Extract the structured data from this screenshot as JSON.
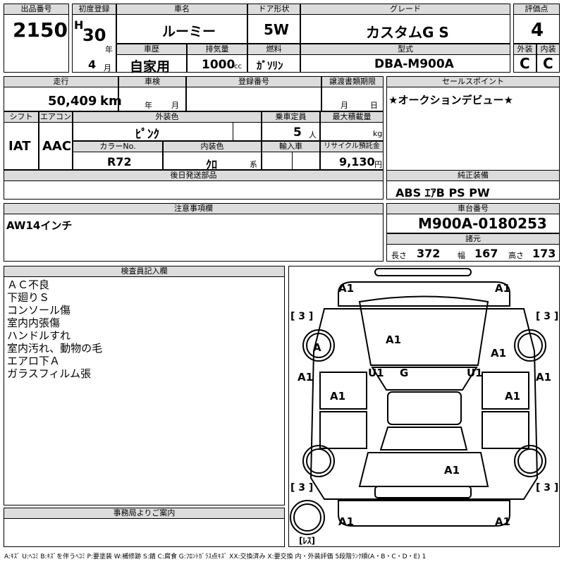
{
  "header": {
    "lot_label": "出品番号",
    "lot_value": "2150",
    "first_reg_label": "初度登録",
    "era": "H",
    "year_num": "30",
    "year_unit": "年",
    "month_num": "4",
    "month_unit": "月",
    "car_name_label": "車名",
    "car_name": "ルーミー",
    "door_label": "ドア形状",
    "door": "5W",
    "grade_label": "グレード",
    "grade": "カスタムG S",
    "score_label": "評価点",
    "score": "4",
    "history_label": "車歴",
    "history": "自家用",
    "displacement_label": "排気量",
    "displacement": "1000",
    "cc_unit": "cc",
    "fuel_label": "燃料",
    "fuel": "ｶﾞｿﾘﾝ",
    "model_label": "型式",
    "model": "DBA-M900A",
    "exterior_label": "外装",
    "exterior": "C",
    "interior_label": "内装",
    "interior": "C"
  },
  "row2": {
    "mileage_label": "走行",
    "mileage": "50,409",
    "mileage_unit": "km",
    "inspection_label": "車検",
    "inspection_year": "年",
    "inspection_month": "月",
    "reg_no_label": "登録番号",
    "transfer_label": "譲渡書類期限",
    "transfer_month": "月",
    "transfer_day": "日",
    "sales_point_label": "セールスポイント",
    "sales_point": "★オークションデビュー★",
    "shift_label": "シフト",
    "shift": "IAT",
    "aircon_label": "エアコン",
    "aircon": "AAC",
    "ext_color_label": "外装色",
    "ext_color": "ﾋﾟﾝｸ",
    "capacity_label": "乗車定員",
    "capacity": "5",
    "capacity_unit": "人",
    "max_load_label": "最大積載量",
    "max_load_unit": "kg",
    "color_no_label": "カラーNo.",
    "color_no": "R72",
    "int_color_label": "内装色",
    "int_color": "ｸﾛ",
    "int_color_unit": "系",
    "import_label": "輸入車",
    "recycle_label": "リサイクル預託金",
    "recycle": "9,130",
    "recycle_unit": "円",
    "later_parts_label": "後日発送部品",
    "equipment_label": "純正装備",
    "equipment": "ABS ｴｱB PS PW"
  },
  "notes": {
    "label": "注意事項欄",
    "text": "AW14インチ",
    "chassis_label": "車台番号",
    "chassis": "M900A-0180253",
    "spec_label": "諸元",
    "length_label": "長さ",
    "length": "372",
    "width_label": "幅",
    "width": "167",
    "height_label": "高さ",
    "height": "173"
  },
  "inspector": {
    "label": "検査員記入欄",
    "lines": [
      "ＡＣ不良",
      "下廻りＳ",
      "コンソール傷",
      "室内内張傷",
      "ハンドルすれ",
      "室内汚れ、動物の毛",
      "エアロ下Ａ",
      "ガラスフィルム張"
    ]
  },
  "office": {
    "label": "事務局よりご案内"
  },
  "diagram": {
    "tire_fl": "[ 3 ]",
    "tire_fr": "[ 3 ]",
    "tire_rl": "[ 3 ]",
    "tire_rr": "[ 3 ]",
    "spare": "[ﾚｽ]",
    "marks": {
      "front_left": "A1",
      "front_right": "A1",
      "hood": "A1",
      "fender_left_wheel": "A",
      "fender_right": "A1",
      "side_left": "A1",
      "side_right": "A1",
      "pillar_left": "U1",
      "pillar_right": "U1",
      "glass": "G",
      "door_left": "A1",
      "door_right": "A1",
      "roof": "A1",
      "rear_left": "A1",
      "rear_right": "A1"
    }
  },
  "legend": "A:ｷｽﾞ U:ﾍｺﾐ B:ｷｽﾞを伴うﾍｺﾐ P:要塗装 W:補修跡 S:錆 C:腐食 G:ﾌﾛﾝﾄｶﾞﾗｽ点ｷｽﾞ XX:交換済み X:要交換 内・外装評価 5段階ﾗﾝｸ順(A・B・C・D・E) 1"
}
